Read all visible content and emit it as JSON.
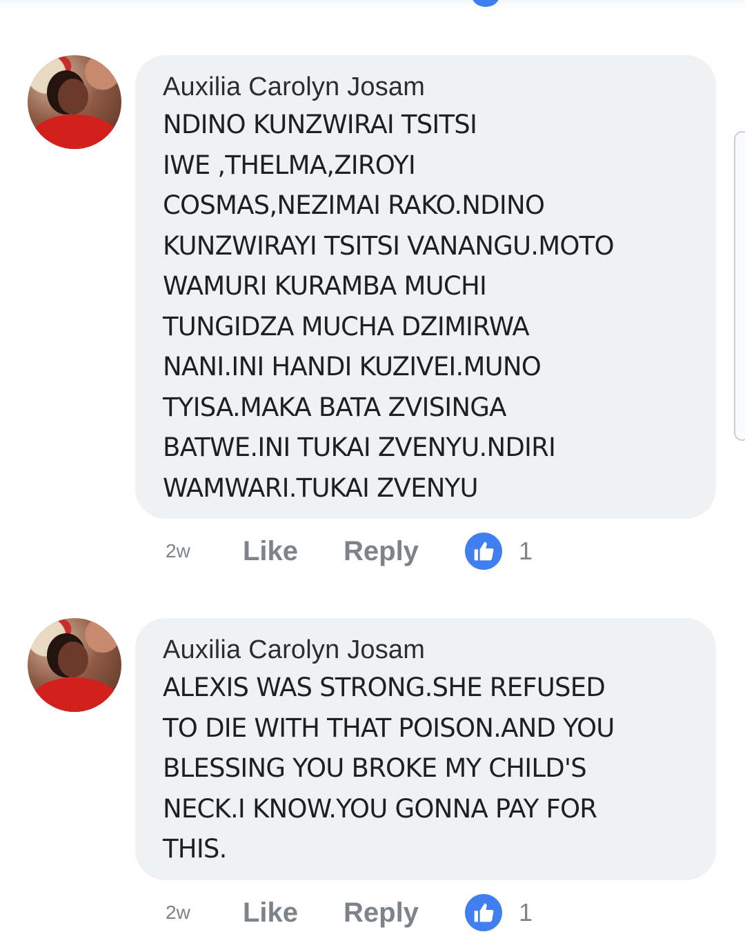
{
  "comments": [
    {
      "author": "Auxilia Carolyn Josam",
      "text": "NDINO KUNZWIRAI TSITSI\nIWE ,THELMA,ZIROYI\nCOSMAS,NEZIMAI RAKO.NDINO\nKUNZWIRAYI TSITSI VANANGU.MOTO\nWAMURI KURAMBA MUCHI\nTUNGIDZA MUCHA DZIMIRWA\nNANI.INI HANDI KUZIVEI.MUNO\nTYISA.MAKA BATA ZVISINGA\nBATWE.INI TUKAI ZVENYU.NDIRI\nWAMWARI.TUKAI ZVENYU",
      "time": "2w",
      "like_label": "Like",
      "reply_label": "Reply",
      "reaction_count": "1"
    },
    {
      "author": "Auxilia Carolyn Josam",
      "text": "ALEXIS WAS STRONG.SHE REFUSED\nTO DIE WITH THAT POISON.AND YOU\nBLESSING YOU BROKE MY CHILD'S\nNECK.I KNOW.YOU GONNA PAY FOR\nTHIS.",
      "time": "2w",
      "like_label": "Like",
      "reply_label": "Reply",
      "reaction_count": "1"
    }
  ],
  "icons": {
    "reaction": "thumbs-up-icon"
  },
  "colors": {
    "bubble": "#f0f1f3",
    "like_blue": "#3f7ff0",
    "meta_text": "#7e838a"
  }
}
